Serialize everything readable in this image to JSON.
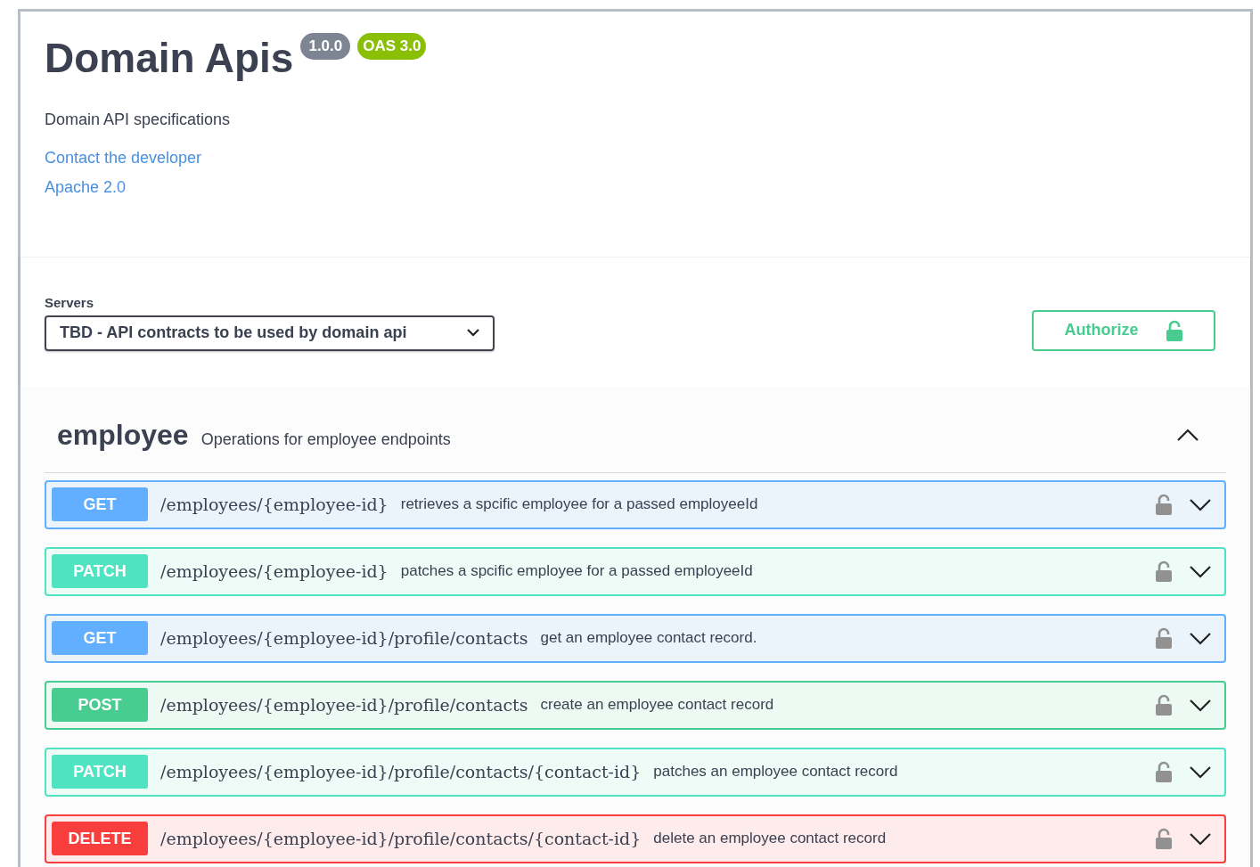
{
  "info": {
    "title": "Domain Apis",
    "version": "1.0.0",
    "oas": "OAS 3.0",
    "description": "Domain API specifications",
    "links": [
      "Contact the developer",
      "Apache 2.0"
    ]
  },
  "servers": {
    "label": "Servers",
    "value": "TBD - API contracts to be used by domain api"
  },
  "authorize": {
    "label": "Authorize"
  },
  "section": {
    "name": "employee",
    "description": "Operations for employee endpoints",
    "expanded": true,
    "operations": [
      {
        "kind": "get",
        "method": "GET",
        "path": "/employees/{employee-id}",
        "summary": "retrieves a spcific employee for a passed employeeId",
        "expanded": false
      },
      {
        "kind": "patch",
        "method": "PATCH",
        "path": "/employees/{employee-id}",
        "summary": "patches a spcific employee for a passed employeeId",
        "expanded": false
      },
      {
        "kind": "get",
        "method": "GET",
        "path": "/employees/{employee-id}/profile/contacts",
        "summary": "get an employee contact record.",
        "expanded": false
      },
      {
        "kind": "post",
        "method": "POST",
        "path": "/employees/{employee-id}/profile/contacts",
        "summary": "create an employee contact record",
        "expanded": false
      },
      {
        "kind": "patch",
        "method": "PATCH",
        "path": "/employees/{employee-id}/profile/contacts/{contact-id}",
        "summary": "patches an employee contact record",
        "expanded": false
      },
      {
        "kind": "delete",
        "method": "DELETE",
        "path": "/employees/{employee-id}/profile/contacts/{contact-id}",
        "summary": "delete an employee contact record",
        "expanded": false
      }
    ]
  }
}
